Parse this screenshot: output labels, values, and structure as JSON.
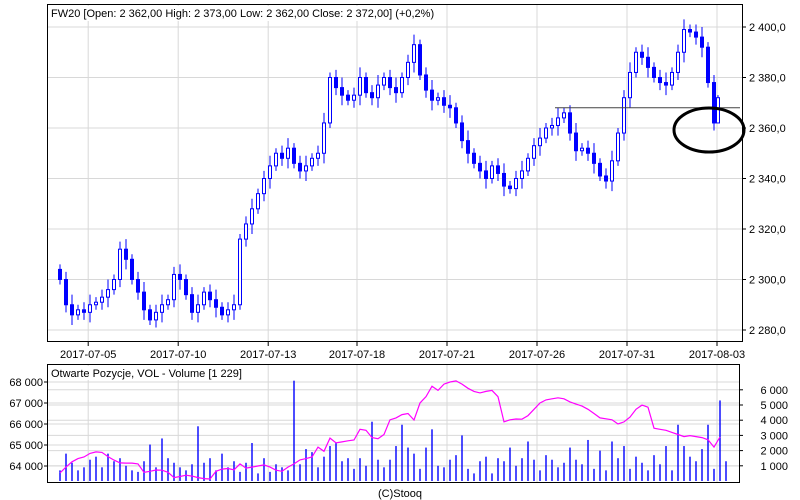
{
  "chart_data": [
    {
      "type": "candlestick",
      "title": "FW20 [Open: 2 362,00  High: 2 373,00  Low: 2 362,00  Close: 2 372,00] (+0,2%)",
      "ylim": [
        2270,
        2408
      ],
      "y_ticks": [
        {
          "value": 2280,
          "label": "2 280,0"
        },
        {
          "value": 2300,
          "label": "2 300,0"
        },
        {
          "value": 2320,
          "label": "2 320,0"
        },
        {
          "value": 2340,
          "label": "2 340,0"
        },
        {
          "value": 2360,
          "label": "2 360,0"
        },
        {
          "value": 2380,
          "label": "2 380,0"
        },
        {
          "value": 2400,
          "label": "2 400,0"
        }
      ],
      "x_ticks": [
        {
          "bar": 4.7,
          "label": "2017-07-05"
        },
        {
          "bar": 19.7,
          "label": "2017-07-10"
        },
        {
          "bar": 34.7,
          "label": "2017-07-13"
        },
        {
          "bar": 49.5,
          "label": "2017-07-18"
        },
        {
          "bar": 64.5,
          "label": "2017-07-21"
        },
        {
          "bar": 79.5,
          "label": "2017-07-26"
        },
        {
          "bar": 94.5,
          "label": "2017-07-31"
        },
        {
          "bar": 109.5,
          "label": "2017-08-03"
        }
      ],
      "first_open": 2304,
      "closes": [
        2300,
        2290,
        2286,
        2288,
        2287,
        2290,
        2291,
        2293,
        2296,
        2300,
        2312,
        2308,
        2300,
        2295,
        2288,
        2284,
        2287,
        2290,
        2292,
        2302,
        2300,
        2294,
        2287,
        2290,
        2295,
        2292,
        2289,
        2286,
        2288,
        2290,
        2316,
        2322,
        2328,
        2334,
        2340,
        2345,
        2350,
        2348,
        2352,
        2346,
        2343,
        2345,
        2348,
        2350,
        2362,
        2380,
        2376,
        2373,
        2371,
        2373,
        2380,
        2374,
        2372,
        2377,
        2380,
        2376,
        2374,
        2380,
        2386,
        2393,
        2381,
        2375,
        2371,
        2372,
        2369,
        2368,
        2362,
        2355,
        2350,
        2346,
        2343,
        2340,
        2345,
        2342,
        2337,
        2336,
        2340,
        2343,
        2348,
        2353,
        2356,
        2360,
        2361,
        2364,
        2366,
        2358,
        2351,
        2352,
        2350,
        2346,
        2341,
        2339,
        2347,
        2358,
        2372,
        2382,
        2390,
        2388,
        2384,
        2380,
        2378,
        2377,
        2382,
        2390,
        2399,
        2398,
        2396,
        2392,
        2378,
        2362,
        2372
      ],
      "reference_line": 2368,
      "annotation": "ellipse around last bars",
      "last_bar": {
        "open": 2362,
        "high": 2373,
        "low": 2362,
        "close": 2372
      }
    },
    {
      "type": "bar+line",
      "title": "Otwarte Pozycje, VOL - Volume [1 229]",
      "left_axis": {
        "series": "Otwarte Pozycje",
        "range": [
          63000,
          68600
        ],
        "ticks": [
          {
            "value": 64000,
            "label": "64 000"
          },
          {
            "value": 65000,
            "label": "65 000"
          },
          {
            "value": 66000,
            "label": "66 000"
          },
          {
            "value": 67000,
            "label": "67 000"
          },
          {
            "value": 68000,
            "label": "68 000"
          }
        ]
      },
      "right_axis": {
        "series": "Volume",
        "range": [
          0,
          6300
        ],
        "ticks": [
          {
            "value": 1000,
            "label": "1 000"
          },
          {
            "value": 2000,
            "label": "2 000"
          },
          {
            "value": 3000,
            "label": "3 000"
          },
          {
            "value": 4000,
            "label": "4 000"
          },
          {
            "value": 5000,
            "label": "5 000"
          },
          {
            "value": 6000,
            "label": "6 000"
          }
        ]
      },
      "open_interest": [
        63670,
        63950,
        64200,
        64350,
        64430,
        64600,
        64670,
        64650,
        64450,
        64280,
        64150,
        64140,
        64140,
        64100,
        63700,
        63750,
        63810,
        63800,
        63700,
        63450,
        63500,
        63560,
        63520,
        63450,
        63400,
        63380,
        63750,
        63850,
        63880,
        63820,
        64100,
        63900,
        63950,
        64000,
        64050,
        63950,
        63800,
        63750,
        63950,
        64100,
        64290,
        64350,
        64430,
        64900,
        64700,
        65330,
        65100,
        65150,
        65200,
        65240,
        65750,
        65700,
        65350,
        65300,
        65500,
        66200,
        66290,
        66450,
        66500,
        66190,
        67000,
        67300,
        67800,
        67600,
        67900,
        68000,
        68050,
        67900,
        67700,
        67550,
        67480,
        67550,
        67600,
        67300,
        66100,
        66200,
        66240,
        66230,
        66400,
        66700,
        67000,
        67150,
        67200,
        67250,
        67200,
        67050,
        66950,
        66850,
        66700,
        66500,
        66290,
        66250,
        66200,
        66000,
        66100,
        66330,
        66700,
        66900,
        66800,
        65800,
        65750,
        65700,
        65600,
        65500,
        65400,
        65450,
        65400,
        65350,
        65250,
        64900,
        65380
      ],
      "volume": [
        700,
        1800,
        1200,
        700,
        900,
        1400,
        1600,
        900,
        1800,
        1300,
        1500,
        1000,
        700,
        600,
        1300,
        2400,
        900,
        2800,
        1500,
        1200,
        900,
        700,
        1100,
        3600,
        1200,
        1500,
        700,
        1800,
        900,
        1300,
        600,
        1200,
        2500,
        500,
        1500,
        600,
        1100,
        900,
        700,
        6600,
        1100,
        2100,
        1900,
        900,
        1600,
        2300,
        2500,
        1300,
        1500,
        800,
        1500,
        1000,
        3900,
        1400,
        900,
        1400,
        2300,
        3700,
        2200,
        1800,
        800,
        2200,
        3400,
        1000,
        900,
        1400,
        1700,
        3000,
        800,
        500,
        1300,
        1600,
        500,
        1500,
        1300,
        2200,
        1000,
        1500,
        2600,
        1400,
        700,
        1700,
        1400,
        900,
        1200,
        2200,
        1400,
        1100,
        2700,
        800,
        2000,
        700,
        2600,
        1500,
        2300,
        800,
        1600,
        1200,
        700,
        1700,
        1100,
        2300,
        700,
        3700,
        2300,
        1600,
        1300,
        2100,
        3700,
        800,
        5300,
        1300
      ],
      "colors": {
        "volume": "#0000ff",
        "open_interest": "#ff00ff"
      }
    }
  ],
  "footer": "(C)Stooq",
  "colors": {
    "candles": "#0000ff",
    "grid": "#d8d8d8"
  }
}
